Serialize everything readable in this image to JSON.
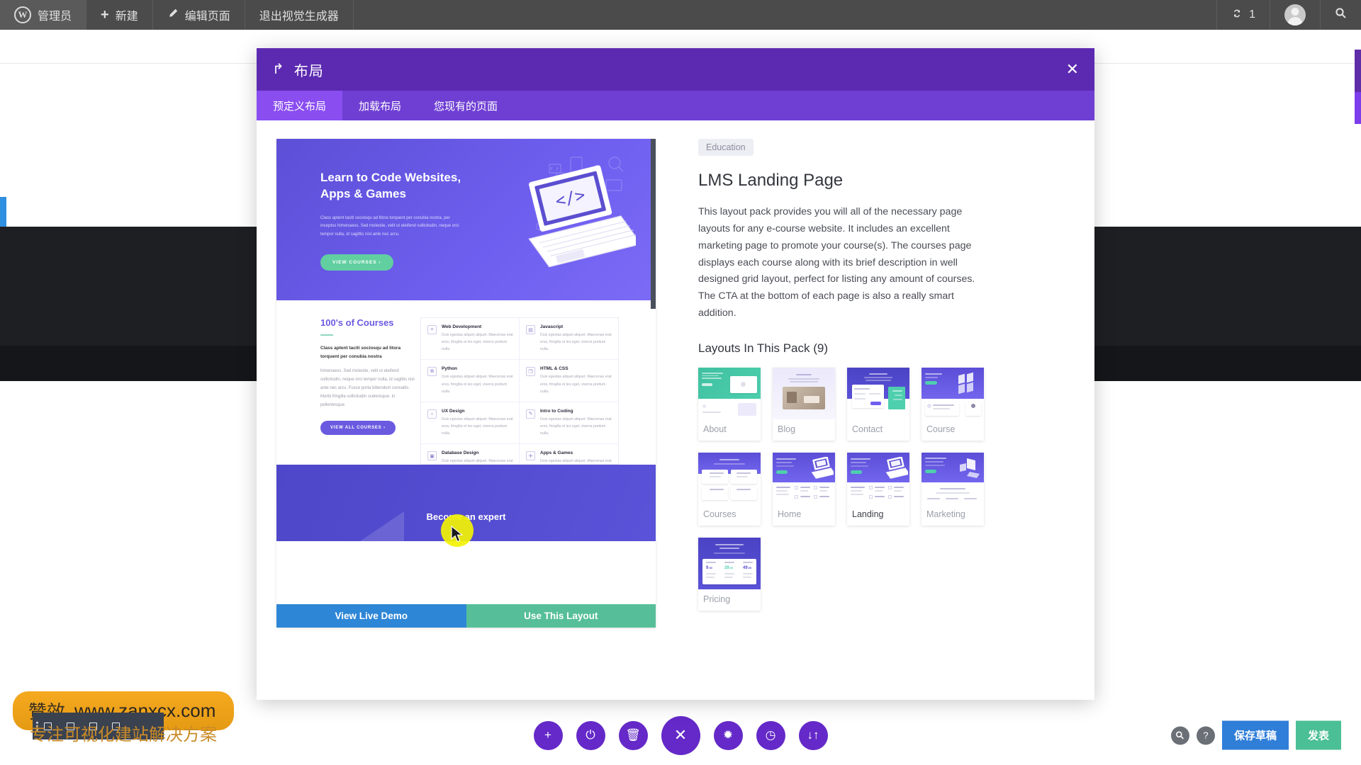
{
  "adminbar": {
    "left_items": [
      {
        "label": "管理员",
        "icon": "wordpress-logo-icon"
      },
      {
        "label": "新建",
        "icon": "plus-icon"
      },
      {
        "label": "编辑页面",
        "icon": "pencil-icon"
      },
      {
        "label": "退出视觉生成器",
        "icon": ""
      }
    ],
    "updates_count": "1",
    "updates_icon": "update-arrows-icon",
    "avatar_icon": "user-avatar-icon",
    "search_icon": "search-icon"
  },
  "modal": {
    "title": "布局",
    "back_icon": "back-arrow-icon",
    "close_icon": "close-icon",
    "tabs": [
      {
        "label": "预定义布局",
        "active": true
      },
      {
        "label": "加载布局",
        "active": false
      },
      {
        "label": "您现有的页面",
        "active": false
      }
    ]
  },
  "preview": {
    "hero": {
      "heading": "Learn to Code Websites, Apps & Games",
      "paragraph": "Class aptent taciti sociosqu ad litora torquent per conubia nostra, per inceptos himenaeos. Sed molestie, velit ut eleifend sollicitudin, neque orci tempor nulla, id sagittis nisl ante nec arcu.",
      "button": "VIEW COURSES  ›"
    },
    "courses": {
      "heading": "100's of Courses",
      "subheading": "Class aptent taciti sociosqu ad litora torquent per conubia nostra",
      "body": "himenaeos. Sed molestie, velit ut eleifend sollicitudin, neque orci tempor nulla, id sagittis nisl ante nec arcu. Fusce porta bibendum convallis. Morbi fringilla sollicitudin scelerisque. In pellentesque",
      "button": "VIEW ALL COURSES  ›",
      "items": [
        {
          "title": "Web Development",
          "desc": "Duis egestas aliquet aliquet. Maecenas erat eros, fringilla et leo eget, viverra pretium nulla.",
          "icon": "browser-code-icon"
        },
        {
          "title": "Javascript",
          "desc": "Duis egestas aliquet aliquet. Maecenas erat eros, fringilla et leo eget, viverra pretium nulla.",
          "icon": "grid-icon"
        },
        {
          "title": "Python",
          "desc": "Duis egestas aliquet aliquet. Maecenas erat eros, fringilla et leo eget, viverra pretium nulla.",
          "icon": "python-icon"
        },
        {
          "title": "HTML & CSS",
          "desc": "Duis egestas aliquet aliquet. Maecenas erat eros, fringilla et leo eget, viverra pretium nulla.",
          "icon": "documents-icon"
        },
        {
          "title": "UX Design",
          "desc": "Duis egestas aliquet aliquet. Maecenas erat eros, fringilla et leo eget, viverra pretium nulla.",
          "icon": "lightbulb-icon"
        },
        {
          "title": "Intro to Coding",
          "desc": "Duis egestas aliquet aliquet. Maecenas erat eros, fringilla et leo eget, viverra pretium nulla.",
          "icon": "pencil-note-icon"
        },
        {
          "title": "Database Design",
          "desc": "Duis egestas aliquet aliquet. Maecenas erat eros, fringilla et leo eget, viverra pretium nulla.",
          "icon": "database-icon"
        },
        {
          "title": "Apps & Games",
          "desc": "Duis egestas aliquet aliquet. Maecenas erat eros, fringilla et leo eget, viverra pretium nulla.",
          "icon": "gamepad-icon"
        }
      ]
    },
    "cta": {
      "text": "Become an expert"
    },
    "actions": {
      "demo": "View Live Demo",
      "use": "Use This Layout"
    }
  },
  "info": {
    "category": "Education",
    "title": "LMS Landing Page",
    "description": "This layout pack provides you will all of the necessary page layouts for any e-course website. It includes an excellent marketing page to promote your course(s). The courses page displays each course along with its brief description in well designed grid layout, perfect for listing any amount of courses. The CTA at the bottom of each page is also a really smart addition.",
    "pack_heading": "Layouts In This Pack (9)",
    "layouts": [
      {
        "name": "About",
        "selected": false,
        "theme": "teal"
      },
      {
        "name": "Blog",
        "selected": false,
        "theme": "light"
      },
      {
        "name": "Contact",
        "selected": false,
        "theme": "indigo"
      },
      {
        "name": "Course",
        "selected": false,
        "theme": "purple"
      },
      {
        "name": "Courses",
        "selected": false,
        "theme": "purple"
      },
      {
        "name": "Home",
        "selected": false,
        "theme": "purple"
      },
      {
        "name": "Landing",
        "selected": true,
        "theme": "purple"
      },
      {
        "name": "Marketing",
        "selected": false,
        "theme": "purple"
      },
      {
        "name": "Pricing",
        "selected": false,
        "theme": "indigo"
      }
    ]
  },
  "bottombar": {
    "buttons": [
      {
        "icon": "plus-icon",
        "glyph": "+"
      },
      {
        "icon": "power-icon",
        "glyph": "⏻"
      },
      {
        "icon": "trash-icon",
        "glyph": "🗑"
      },
      {
        "icon": "close-icon",
        "glyph": "✕"
      },
      {
        "icon": "gear-icon",
        "glyph": "✹"
      },
      {
        "icon": "history-clock-icon",
        "glyph": "◷"
      },
      {
        "icon": "sort-arrows-icon",
        "glyph": "↓↑"
      }
    ],
    "zoom_icon": "magnifier-icon",
    "help_icon": "question-mark-icon",
    "save_draft": "保存草稿",
    "publish": "发表"
  },
  "watermark": {
    "brand": "赞效",
    "url": "www.zanxcx.com",
    "tagline": "专注可视化建站解决方案"
  },
  "colors": {
    "admin_bar": "#4b4b4b",
    "modal_header": "#5c2ab1",
    "modal_tabs": "#6f3fd4",
    "tab_active": "#8a4df0",
    "demo_button": "#2e86d6",
    "use_button": "#56bf9a",
    "save_button": "#2f7ed8",
    "publish_button": "#4bbf96",
    "toolbar_button": "#6429c8",
    "watermark": "#f5a91f"
  }
}
